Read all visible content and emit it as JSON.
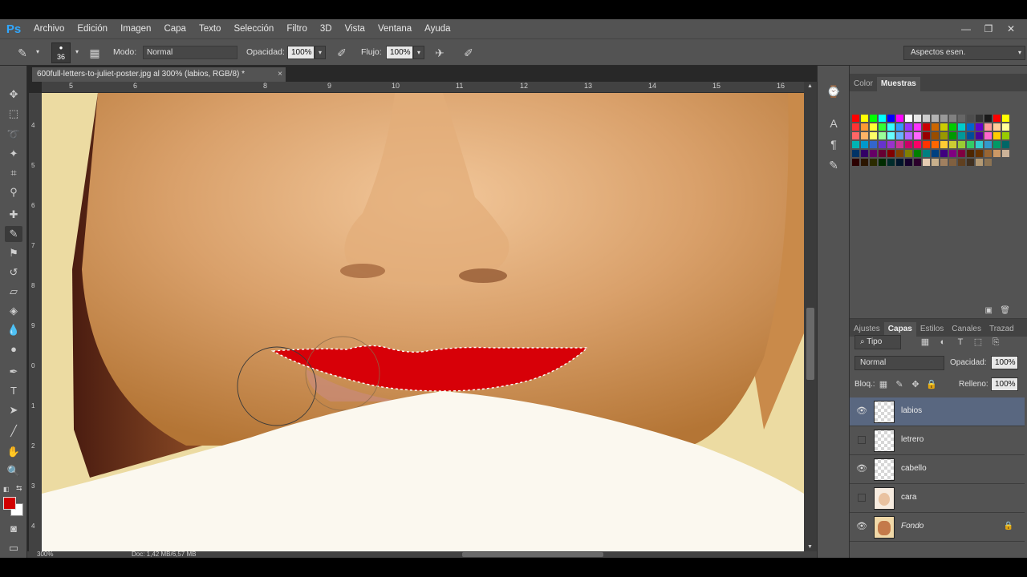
{
  "app": {
    "logo": "Ps"
  },
  "menu": [
    "Archivo",
    "Edición",
    "Imagen",
    "Capa",
    "Texto",
    "Selección",
    "Filtro",
    "3D",
    "Vista",
    "Ventana",
    "Ayuda"
  ],
  "window_controls": {
    "minimize": "—",
    "restore": "❐",
    "close": "✕"
  },
  "options": {
    "brush_size": "36",
    "mode_label": "Modo:",
    "mode_value": "Normal",
    "opacity_label": "Opacidad:",
    "opacity_value": "100%",
    "flow_label": "Flujo:",
    "flow_value": "100%",
    "workspace": "Aspectos esen."
  },
  "document": {
    "tab_title": "600full-letters-to-juliet-poster.jpg al 300% (labios, RGB/8) *",
    "close": "×",
    "ruler_ticks": [
      "5",
      "6",
      "8",
      "9",
      "10",
      "11",
      "12",
      "13",
      "14",
      "15",
      "16"
    ],
    "vruler_ticks": [
      "4",
      "5",
      "6",
      "7",
      "8",
      "9",
      "0",
      "1",
      "2",
      "3",
      "4"
    ],
    "zoom": "300%",
    "doc_size": "Doc: 1,42 MB/6,57 MB"
  },
  "swatches_panel": {
    "tabs": [
      "Color",
      "Muestras"
    ],
    "active_tab": "Muestras",
    "colors": [
      "#ff0000",
      "#ffff00",
      "#00ff00",
      "#00ffff",
      "#0000ff",
      "#ff00ff",
      "#ffffff",
      "#e6e6e6",
      "#cccccc",
      "#b3b3b3",
      "#999999",
      "#808080",
      "#666666",
      "#4d4d4d",
      "#333333",
      "#1a1a1a",
      "#ff0000",
      "#ffff00",
      "#ff3333",
      "#ff9933",
      "#ffff33",
      "#33ff33",
      "#33ffff",
      "#3399ff",
      "#9933ff",
      "#ff33ff",
      "#cc0000",
      "#cc6600",
      "#cccc00",
      "#00cc00",
      "#00cccc",
      "#0066cc",
      "#6600cc",
      "#ff9999",
      "#ffcc99",
      "#ffff99",
      "#ff6666",
      "#ffb366",
      "#ffff66",
      "#99ff99",
      "#66ffff",
      "#66b3ff",
      "#b366ff",
      "#ff66ff",
      "#990000",
      "#994d00",
      "#999900",
      "#009900",
      "#009999",
      "#004d99",
      "#4d0099",
      "#ff66cc",
      "#ffcc00",
      "#99cc00",
      "#00b3b3",
      "#0099cc",
      "#3366cc",
      "#6633cc",
      "#9933cc",
      "#cc3399",
      "#cc0066",
      "#ff0066",
      "#ff3300",
      "#ff6600",
      "#ffcc33",
      "#cccc33",
      "#99cc33",
      "#33cc66",
      "#33cccc",
      "#3399cc",
      "#009966",
      "#006666",
      "#003366",
      "#330066",
      "#660066",
      "#660033",
      "#800000",
      "#804000",
      "#808000",
      "#008000",
      "#008080",
      "#004080",
      "#400080",
      "#800080",
      "#800040",
      "#4d2600",
      "#663300",
      "#996633",
      "#cc9966",
      "#ccb399",
      "#2b0000",
      "#2b1500",
      "#2b2b00",
      "#002b00",
      "#002b2b",
      "#00152b",
      "#15002b",
      "#2b002b",
      "#e6ccb3",
      "#c8b08c",
      "#a08060",
      "#806040",
      "#604020",
      "#403020",
      "#b39973",
      "#8c7353"
    ]
  },
  "layers_panel": {
    "tabs": [
      "Ajustes",
      "Capas",
      "Estilos",
      "Canales",
      "Trazad"
    ],
    "active_tab": "Capas",
    "filter_value": "Tipo",
    "blend_mode": "Normal",
    "opacity_label": "Opacidad:",
    "opacity_value": "100%",
    "lock_label": "Bloq.:",
    "fill_label": "Relleno:",
    "fill_value": "100%",
    "layers": [
      {
        "name": "labios",
        "visible": true,
        "selected": true
      },
      {
        "name": "letrero",
        "visible": false,
        "selected": false
      },
      {
        "name": "cabello",
        "visible": true,
        "selected": false
      },
      {
        "name": "cara",
        "visible": false,
        "selected": false
      },
      {
        "name": "Fondo",
        "visible": true,
        "selected": false,
        "locked": true
      }
    ]
  }
}
